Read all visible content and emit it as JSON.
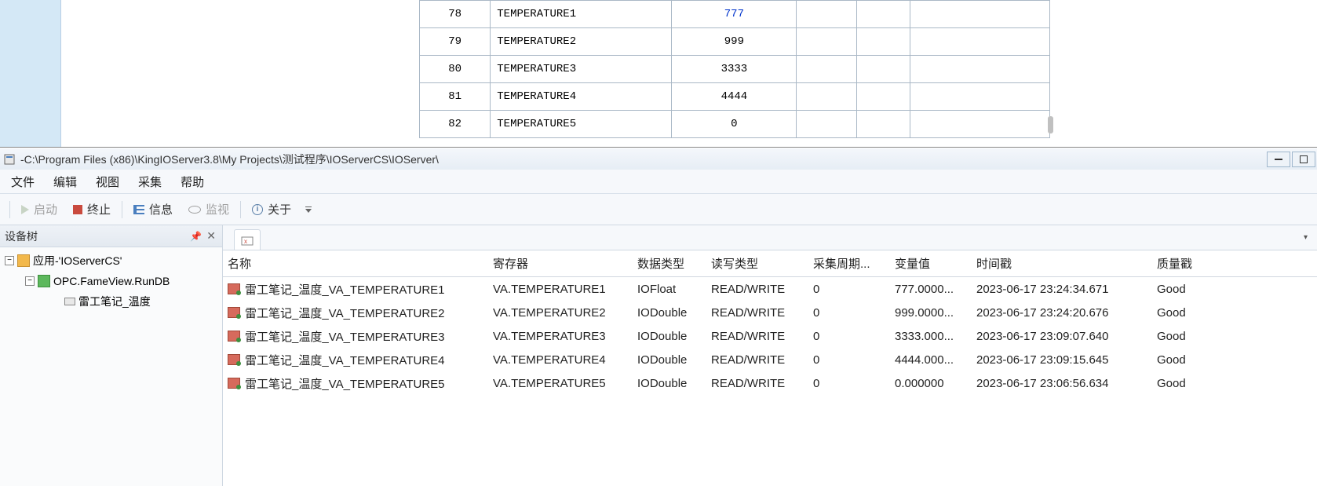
{
  "upper_table": {
    "rows": [
      {
        "id": "78",
        "name": "TEMPERATURE1",
        "value": "777",
        "highlight": true
      },
      {
        "id": "79",
        "name": "TEMPERATURE2",
        "value": "999",
        "highlight": false
      },
      {
        "id": "80",
        "name": "TEMPERATURE3",
        "value": "3333",
        "highlight": false
      },
      {
        "id": "81",
        "name": "TEMPERATURE4",
        "value": "4444",
        "highlight": false
      },
      {
        "id": "82",
        "name": "TEMPERATURE5",
        "value": "0",
        "highlight": false
      }
    ]
  },
  "titlebar": {
    "path": "-C:\\Program Files (x86)\\KingIOServer3.8\\My Projects\\测试程序\\IOServerCS\\IOServer\\"
  },
  "menu": {
    "file": "文件",
    "edit": "编辑",
    "view": "视图",
    "collect": "采集",
    "help": "帮助"
  },
  "toolbar": {
    "start": "启动",
    "stop": "终止",
    "info": "信息",
    "monitor": "监视",
    "about": "关于"
  },
  "tree": {
    "title": "设备树",
    "app_label": "应用-'IOServerCS'",
    "opc_label": "OPC.FameView.RunDB",
    "device_label": "雷工笔记_温度"
  },
  "grid": {
    "headers": {
      "name": "名称",
      "register": "寄存器",
      "datatype": "数据类型",
      "rwtype": "读写类型",
      "cycle": "采集周期...",
      "value": "变量值",
      "timestamp": "时间戳",
      "quality": "质量戳"
    },
    "rows": [
      {
        "name": "雷工笔记_温度_VA_TEMPERATURE1",
        "register": "VA.TEMPERATURE1",
        "datatype": "IOFloat",
        "rw": "READ/WRITE",
        "cycle": "0",
        "value": "777.0000...",
        "ts": "2023-06-17 23:24:34.671",
        "q": "Good"
      },
      {
        "name": "雷工笔记_温度_VA_TEMPERATURE2",
        "register": "VA.TEMPERATURE2",
        "datatype": "IODouble",
        "rw": "READ/WRITE",
        "cycle": "0",
        "value": "999.0000...",
        "ts": "2023-06-17 23:24:20.676",
        "q": "Good"
      },
      {
        "name": "雷工笔记_温度_VA_TEMPERATURE3",
        "register": "VA.TEMPERATURE3",
        "datatype": "IODouble",
        "rw": "READ/WRITE",
        "cycle": "0",
        "value": "3333.000...",
        "ts": "2023-06-17 23:09:07.640",
        "q": "Good"
      },
      {
        "name": "雷工笔记_温度_VA_TEMPERATURE4",
        "register": "VA.TEMPERATURE4",
        "datatype": "IODouble",
        "rw": "READ/WRITE",
        "cycle": "0",
        "value": "4444.000...",
        "ts": "2023-06-17 23:09:15.645",
        "q": "Good"
      },
      {
        "name": "雷工笔记_温度_VA_TEMPERATURE5",
        "register": "VA.TEMPERATURE5",
        "datatype": "IODouble",
        "rw": "READ/WRITE",
        "cycle": "0",
        "value": "0.000000",
        "ts": "2023-06-17 23:06:56.634",
        "q": "Good"
      }
    ]
  }
}
